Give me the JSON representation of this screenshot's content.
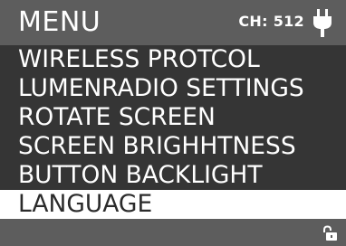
{
  "header": {
    "title": "MENU",
    "channel": "CH: 512",
    "power_icon": "plug-icon"
  },
  "menu": {
    "items": [
      {
        "label": "WIRELESS PROTCOL"
      },
      {
        "label": "LUMENRADIO SETTINGS"
      },
      {
        "label": "ROTATE SCREEN"
      },
      {
        "label": "SCREEN BRIGHHTNESS"
      },
      {
        "label": "BUTTON BACKLIGHT"
      },
      {
        "label": "LANGUAGE",
        "selected": true
      }
    ]
  },
  "footer": {
    "lock_icon": "unlocked-padlock-icon"
  },
  "colors": {
    "header_bg": "#5d5d5d",
    "menu_bg": "#353535",
    "selected_bg": "#ffffff",
    "text": "#ffffff",
    "selected_text": "#2b2b2b"
  }
}
